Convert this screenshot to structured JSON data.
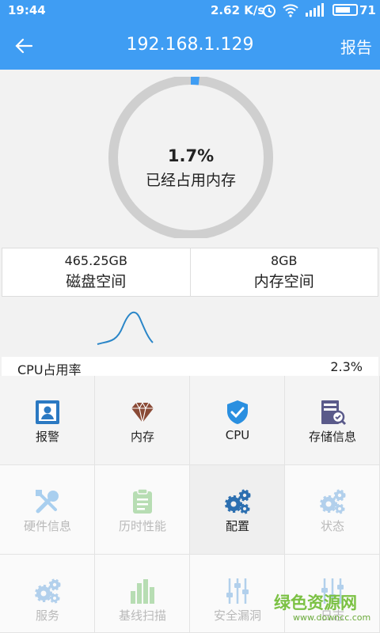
{
  "status_bar": {
    "time": "19:44",
    "speed": "2.62 K/s",
    "battery": "71"
  },
  "header": {
    "title": "192.168.1.129",
    "report_label": "报告"
  },
  "memory_ring": {
    "percent_text": "1.7%",
    "label": "已经占用内存",
    "fraction": 0.017
  },
  "stats": [
    {
      "value": "465.25GB",
      "label": "磁盘空间"
    },
    {
      "value": "8GB",
      "label": "内存空间"
    }
  ],
  "cpu": {
    "label": "CPU占用率",
    "value": "2.3%"
  },
  "grid": [
    {
      "label": "报警",
      "icon": "alarm-icon",
      "color": "#2b79c2"
    },
    {
      "label": "内存",
      "icon": "diamond-icon",
      "color": "#8a4a36"
    },
    {
      "label": "CPU",
      "icon": "shield-check-icon",
      "color": "#2a8fe0"
    },
    {
      "label": "存储信息",
      "icon": "storage-search-icon",
      "color": "#5a5a8a"
    },
    {
      "label": "硬件信息",
      "icon": "wrench-icon",
      "color": "#a9cfef"
    },
    {
      "label": "历时性能",
      "icon": "clipboard-icon",
      "color": "#b7ddb3"
    },
    {
      "label": "配置",
      "icon": "gears-icon",
      "color": "#2c6fb0"
    },
    {
      "label": "状态",
      "icon": "gears-icon",
      "color": "#b2d0ec"
    },
    {
      "label": "服务",
      "icon": "gears-icon",
      "color": "#b2d0ec"
    },
    {
      "label": "基线扫描",
      "icon": "bar-chart-icon",
      "color": "#b7ddb3"
    },
    {
      "label": "安全漏洞",
      "icon": "sliders-icon",
      "color": "#b2d0ec"
    },
    {
      "label": "日志",
      "icon": "sliders-icon",
      "color": "#b2d0ec"
    }
  ],
  "watermark": {
    "text": "绿色资源网",
    "sub": "www.downcc.com"
  },
  "colors": {
    "accent": "#3f9df3",
    "ring_track": "#cfcfcf",
    "ring_fill": "#3f9df3"
  }
}
